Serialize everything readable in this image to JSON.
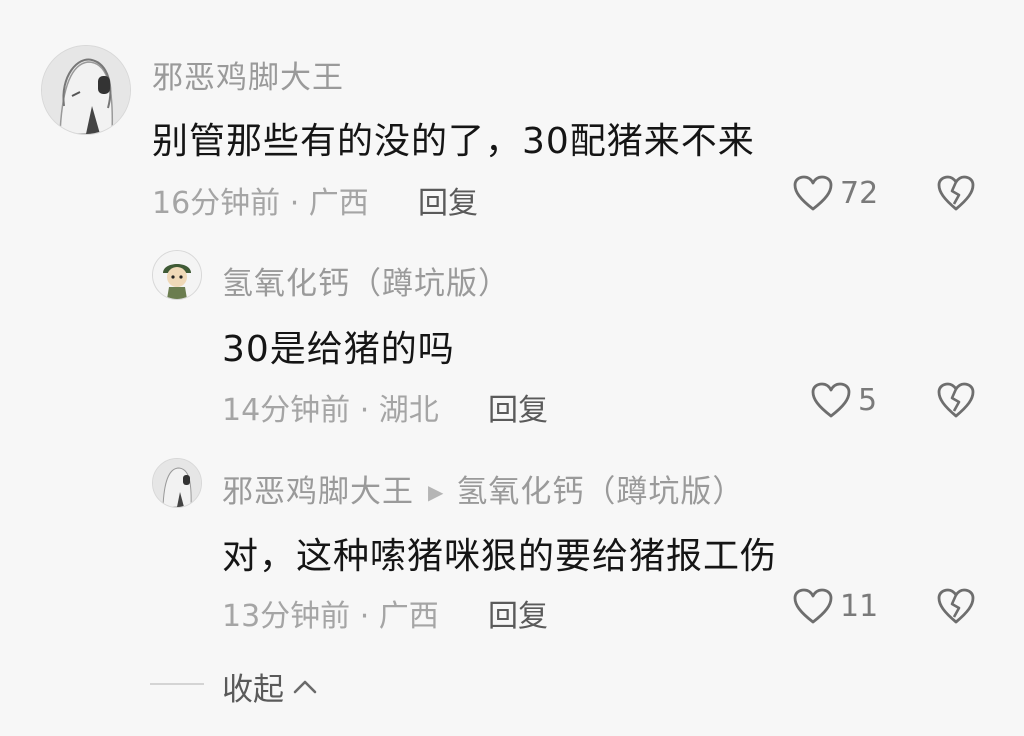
{
  "comments": [
    {
      "username": "邪恶鸡脚大王",
      "content": "别管那些有的没的了，30配猪来不来",
      "meta": "16分钟前 · 广西",
      "reply_label": "回复",
      "likes": "72"
    },
    {
      "username": "氢氧化钙（蹲坑版）",
      "content": "30是给猪的吗",
      "meta": "14分钟前 · 湖北",
      "reply_label": "回复",
      "likes": "5"
    },
    {
      "username": "邪恶鸡脚大王",
      "reply_to": "氢氧化钙（蹲坑版）",
      "content": "对，这种嗦猪咪狠的要给猪报工伤",
      "meta": "13分钟前 · 广西",
      "reply_label": "回复",
      "likes": "11"
    }
  ],
  "collapse_label": "收起",
  "icons": {
    "like": "heart-outline-icon",
    "dislike": "broken-heart-icon",
    "reply_arrow": "triangle-right-icon",
    "collapse": "chevron-up-icon"
  },
  "colors": {
    "background": "#f7f7f7",
    "username": "#9a9a9a",
    "content": "#151515",
    "meta": "#a5a5a5",
    "action": "#5a5a5a"
  }
}
